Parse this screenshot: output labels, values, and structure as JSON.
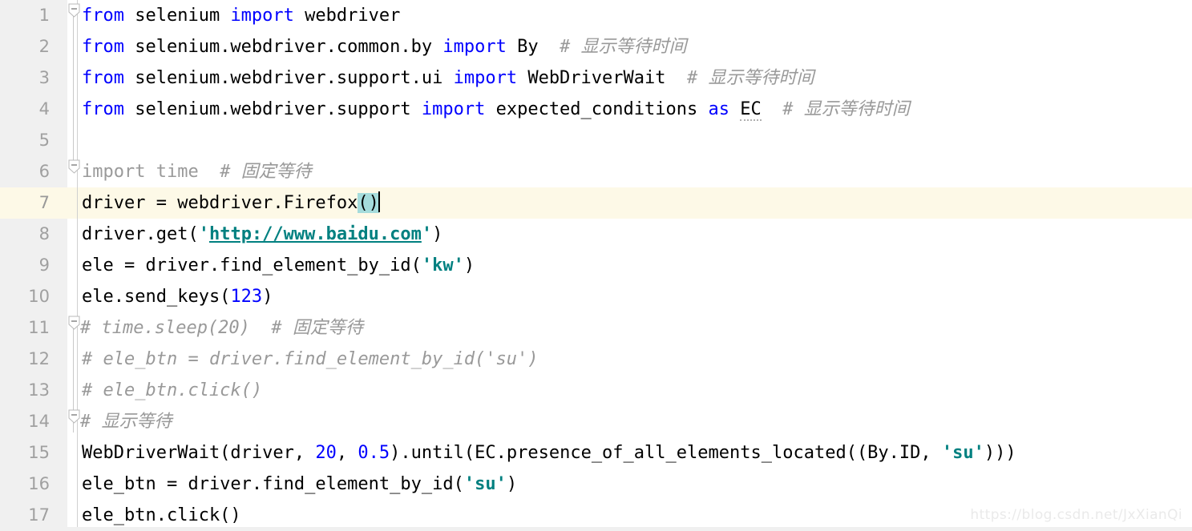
{
  "editor": {
    "language": "Python",
    "colors": {
      "background": "#ffffff",
      "gutter": "#f0f0f0",
      "current_line": "#fdf9e7",
      "keyword": "#0000ff",
      "string": "#008080",
      "number": "#0000ff",
      "comment": "#999999",
      "bracket_highlight": "#a5dcdc",
      "line_number": "#a0a0a0",
      "watermark": "#eaeaea"
    },
    "current_line_number": 7,
    "caret_line": 7,
    "caret_column": 31
  },
  "line_numbers": [
    "1",
    "2",
    "3",
    "4",
    "5",
    "6",
    "7",
    "8",
    "9",
    "10",
    "11",
    "12",
    "13",
    "14",
    "15",
    "16",
    "17"
  ],
  "lines": [
    {
      "n": "1",
      "text": "from selenium import webdriver"
    },
    {
      "n": "2",
      "text": "from selenium.webdriver.common.by import By  # 显示等待时间"
    },
    {
      "n": "3",
      "text": "from selenium.webdriver.support.ui import WebDriverWait  # 显示等待时间"
    },
    {
      "n": "4",
      "text": "from selenium.webdriver.support import expected_conditions as EC  # 显示等待时间"
    },
    {
      "n": "5",
      "text": ""
    },
    {
      "n": "6",
      "text": "import time  # 固定等待"
    },
    {
      "n": "7",
      "text": "driver = webdriver.Firefox()"
    },
    {
      "n": "8",
      "text": "driver.get('http://www.baidu.com')"
    },
    {
      "n": "9",
      "text": "ele = driver.find_element_by_id('kw')"
    },
    {
      "n": "10",
      "text": "ele.send_keys(123)"
    },
    {
      "n": "11",
      "text": "# time.sleep(20)  # 固定等待"
    },
    {
      "n": "12",
      "text": "# ele_btn = driver.find_element_by_id('su')"
    },
    {
      "n": "13",
      "text": "# ele_btn.click()"
    },
    {
      "n": "14",
      "text": "# 显示等待"
    },
    {
      "n": "15",
      "text": "WebDriverWait(driver, 20, 0.5).until(EC.presence_of_all_elements_located((By.ID, 'su')))"
    },
    {
      "n": "16",
      "text": "ele_btn = driver.find_element_by_id('su')"
    },
    {
      "n": "17",
      "text": "ele_btn.click()"
    }
  ],
  "tokens": {
    "l1": {
      "kw1": "from",
      "mod": " selenium ",
      "kw2": "import",
      "name": " webdriver"
    },
    "l2": {
      "kw1": "from",
      "mod": " selenium.webdriver.common.by ",
      "kw2": "import",
      "name": " By",
      "comment": "  # 显示等待时间"
    },
    "l3": {
      "kw1": "from",
      "mod": " selenium.webdriver.support.ui ",
      "kw2": "import",
      "name": " WebDriverWait",
      "comment": "  # 显示等待时间"
    },
    "l4": {
      "kw1": "from",
      "mod": " selenium.webdriver.support ",
      "kw2": "import",
      "name": " expected_conditions ",
      "kw3": "as",
      "alias": "EC",
      "comment": "  # 显示等待时间"
    },
    "l6": {
      "stmt": "import time",
      "comment": "  # 固定等待"
    },
    "l7": {
      "pre": "driver = webdriver.Firefox",
      "brackets": "()"
    },
    "l8": {
      "pre": "driver.get(",
      "q1": "'",
      "url": "http://www.baidu.com",
      "q2": "'",
      "post": ")"
    },
    "l9": {
      "pre": "ele = driver.find_element_by_id(",
      "str": "'kw'",
      "post": ")"
    },
    "l10": {
      "pre": "ele.send_keys(",
      "num": "123",
      "post": ")"
    },
    "l11": {
      "comment": "# time.sleep(20)  # 固定等待"
    },
    "l12": {
      "comment": "# ele_btn = driver.find_element_by_id('su')"
    },
    "l13": {
      "comment": "# ele_btn.click()"
    },
    "l14": {
      "comment": "# 显示等待"
    },
    "l15": {
      "p1": "WebDriverWait(driver, ",
      "n1": "20",
      "p2": ", ",
      "n2": "0.5",
      "p3": ").until(EC.presence_of_all_elements_located((By.ID, ",
      "s1": "'su'",
      "p4": ")))"
    },
    "l16": {
      "pre": "ele_btn = driver.find_element_by_id(",
      "str": "'su'",
      "post": ")"
    },
    "l17": {
      "text": "ele_btn.click()"
    }
  },
  "fold_markers": [
    {
      "line": 1,
      "state": "expanded",
      "glyph": "minus"
    },
    {
      "line": 6,
      "state": "expanded",
      "glyph": "minus"
    },
    {
      "line": 11,
      "state": "expanded",
      "glyph": "minus"
    },
    {
      "line": 14,
      "state": "expanded",
      "glyph": "minus"
    }
  ],
  "watermark": {
    "text": "https://blog.csdn.net/JxXianQi"
  }
}
